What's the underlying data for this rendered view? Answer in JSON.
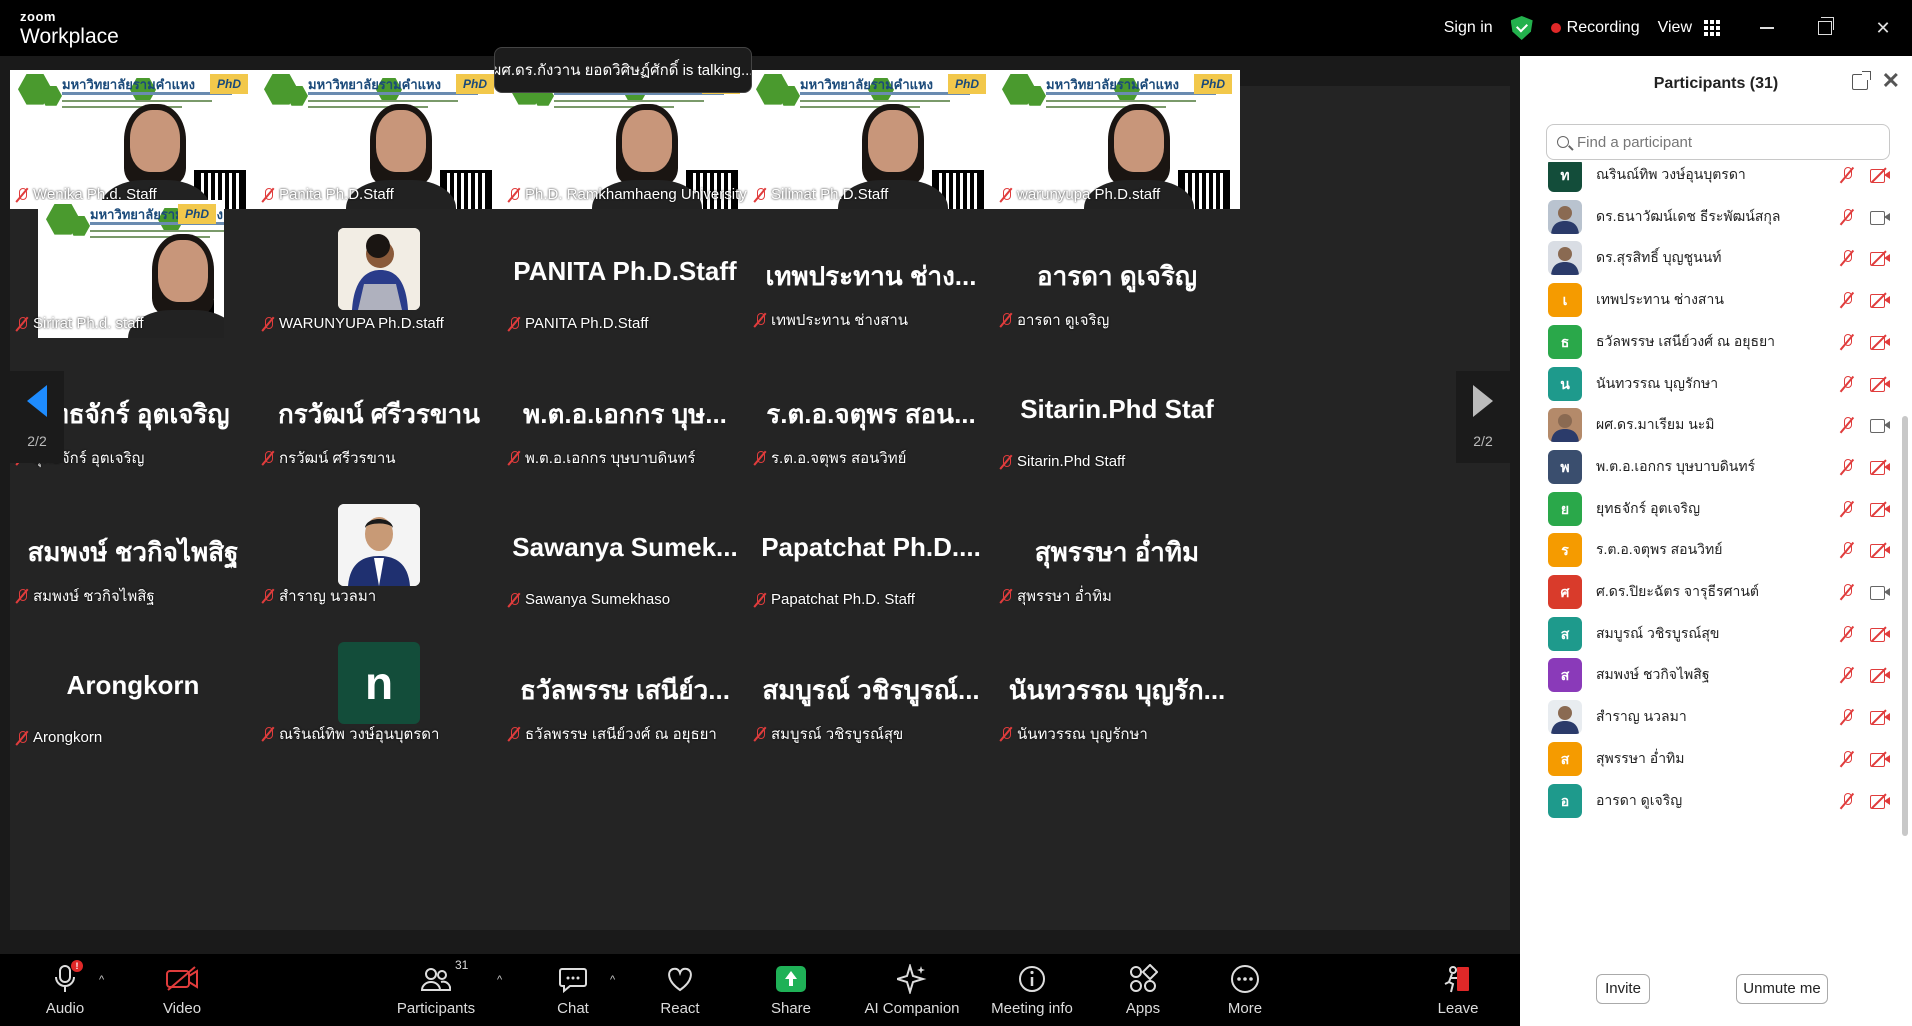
{
  "app": {
    "brand_small": "zoom",
    "brand_big": "Workplace"
  },
  "topbar": {
    "sign_in": "Sign in",
    "recording": "Recording",
    "view": "View"
  },
  "talking": "ผศ.ดร.กังวาน ยอดวิศิษฏ์ศักดิ์ is talking...",
  "banner": {
    "university": "มหาวิทยาลัยรามคำแหง",
    "logo": "PhD"
  },
  "video_tiles": [
    {
      "name": "Wenika Ph.d. Staff"
    },
    {
      "name": "Panita Ph.D.Staff"
    },
    {
      "name": "Ph.D. Ramkhamhaeng University"
    },
    {
      "name": "Silimat Ph.D.Staff"
    },
    {
      "name": "warunyupa Ph.D.staff"
    }
  ],
  "rows": [
    [
      {
        "display": "",
        "name": "Sirirat Ph.d. staff",
        "kind": "video"
      },
      {
        "display": "",
        "name": "WARUNYUPA Ph.D.staff",
        "kind": "photo"
      },
      {
        "display": "PANITA Ph.D.Staff",
        "name": "PANITA Ph.D.Staff",
        "kind": "text"
      },
      {
        "display": "เทพประทาน ช่าง...",
        "name": "เทพประทาน ช่างสาน",
        "kind": "text"
      },
      {
        "display": "อารดา ดูเจริญ",
        "name": "อารดา ดูเจริญ",
        "kind": "text"
      }
    ],
    [
      {
        "display": "ยุทธจักร์ อุตเจริญ",
        "name": "ยุทธจักร์ อุตเจริญ",
        "kind": "text"
      },
      {
        "display": "กรวัฒน์ ศรีวรขาน",
        "name": "กรวัฒน์ ศรีวรขาน",
        "kind": "text"
      },
      {
        "display": "พ.ต.อ.เอกกร บุษ...",
        "name": "พ.ต.อ.เอกกร บุษบาบดินทร์",
        "kind": "text"
      },
      {
        "display": "ร.ต.อ.จตุพร สอน...",
        "name": "ร.ต.อ.จตุพร สอนวิทย์",
        "kind": "text"
      },
      {
        "display": "Sitarin.Phd Staf",
        "name": "Sitarin.Phd Staff",
        "kind": "text"
      }
    ],
    [
      {
        "display": "สมพงษ์ ชวกิจไพสิฐ",
        "name": "สมพงษ์ ชวกิจไพสิฐ",
        "kind": "text"
      },
      {
        "display": "",
        "name": "สำราญ นวลมา",
        "kind": "photo2"
      },
      {
        "display": "Sawanya Sumek...",
        "name": "Sawanya Sumekhaso",
        "kind": "text"
      },
      {
        "display": "Papatchat Ph.D....",
        "name": "Papatchat Ph.D. Staff",
        "kind": "text"
      },
      {
        "display": "สุพรรษา อ่ำทิม",
        "name": "สุพรรษา อ่ำทิม",
        "kind": "text"
      }
    ],
    [
      {
        "display": "Arongkorn",
        "name": "Arongkorn",
        "kind": "text"
      },
      {
        "display": "n",
        "name": "ณรินณ์ทิพ วงษ์อุนบุตรดา",
        "kind": "letter"
      },
      {
        "display": "ธวัลพรรษ เสนีย์ว...",
        "name": "ธวัลพรรษ เสนีย์วงศ์ ณ อยุธยา",
        "kind": "text"
      },
      {
        "display": "สมบูรณ์ วชิรบูรณ์...",
        "name": "สมบูรณ์ วชิรบูรณ์สุข",
        "kind": "text"
      },
      {
        "display": "นันทวรรณ บุญรัก...",
        "name": "นันทวรรณ บุญรักษา",
        "kind": "text"
      }
    ]
  ],
  "pager": {
    "label": "2/2"
  },
  "toolbar": {
    "audio": "Audio",
    "video": "Video",
    "participants": "Participants",
    "participants_count": "31",
    "chat": "Chat",
    "react": "React",
    "share": "Share",
    "ai": "AI Companion",
    "meeting_info": "Meeting info",
    "apps": "Apps",
    "more": "More",
    "leave": "Leave"
  },
  "panel": {
    "title": "Participants (31)",
    "search_placeholder": "Find a participant",
    "invite": "Invite",
    "unmute": "Unmute me",
    "participants": [
      {
        "initial": "ท",
        "color": "#134d3a",
        "name": "ณรินณ์ทิพ วงษ์อุนบุตรดา",
        "video": false
      },
      {
        "initial": "",
        "color": "#b9c3cf",
        "name": "ดร.ธนาวัฒน์เดช ธีระพัฒน์สกุล",
        "video": true
      },
      {
        "initial": "",
        "color": "#d9dde4",
        "name": "ดร.สุรสิทธิ์ บุญชูนนท์",
        "video": false
      },
      {
        "initial": "เ",
        "color": "#f59b00",
        "name": "เทพประทาน ช่างสาน",
        "video": false
      },
      {
        "initial": "ธ",
        "color": "#2aa84a",
        "name": "ธวัลพรรษ เสนีย์วงศ์ ณ อยุธยา",
        "video": false
      },
      {
        "initial": "น",
        "color": "#1e9a8c",
        "name": "นันทวรรณ บุญรักษา",
        "video": false
      },
      {
        "initial": "",
        "color": "#b48a6a",
        "name": "ผศ.ดร.มาเรียม นะมิ",
        "video": true
      },
      {
        "initial": "พ",
        "color": "#3a4e6e",
        "name": "พ.ต.อ.เอกกร บุษบาบดินทร์",
        "video": false
      },
      {
        "initial": "ย",
        "color": "#2aa84a",
        "name": "ยุทธจักร์ อุตเจริญ",
        "video": false
      },
      {
        "initial": "ร",
        "color": "#f59b00",
        "name": "ร.ต.อ.จตุพร สอนวิทย์",
        "video": false
      },
      {
        "initial": "ศ",
        "color": "#d93b2b",
        "name": "ศ.ดร.ปิยะฉัตร จารุธีรศานต์",
        "video": true
      },
      {
        "initial": "ส",
        "color": "#1e9a8c",
        "name": "สมบูรณ์ วชิรบูรณ์สุข",
        "video": false
      },
      {
        "initial": "ส",
        "color": "#8a3ab9",
        "name": "สมพงษ์ ชวกิจไพสิฐ",
        "video": false
      },
      {
        "initial": "",
        "color": "#e8ecf0",
        "name": "สำราญ นวลมา",
        "video": false
      },
      {
        "initial": "ส",
        "color": "#f59b00",
        "name": "สุพรรษา อ่ำทิม",
        "video": false
      },
      {
        "initial": "อ",
        "color": "#1e9a8c",
        "name": "อารดา ดูเจริญ",
        "video": false
      }
    ]
  }
}
